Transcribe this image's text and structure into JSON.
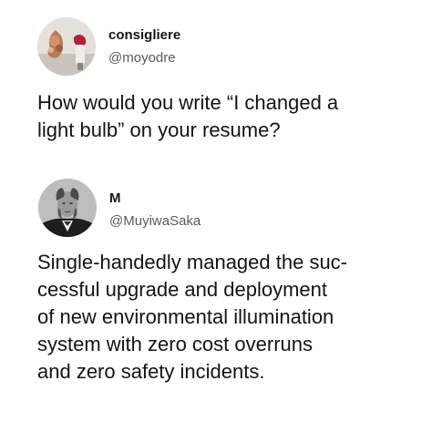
{
  "tweets": [
    {
      "display_name": "consigliere",
      "handle": "@moyodre",
      "avatar_icon": "flower-avatar-icon",
      "text": "How would you write “I changed a\nlight bulb” on your resume?"
    },
    {
      "display_name": "M",
      "handle": "@MuyiwaSaka",
      "avatar_icon": "portrait-avatar-icon",
      "text": "Single-handedly managed the suc-\ncessful upgrade and deployment\nof new environmental illumination\nsystem with zero cost overruns\nand zero safety incidents."
    }
  ],
  "colors": {
    "background": "#ffffff",
    "text": "#141414",
    "handle": "#5a5a5a"
  }
}
